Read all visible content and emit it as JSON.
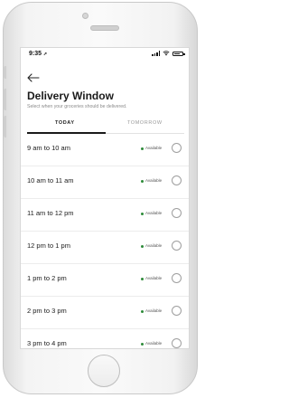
{
  "status_bar": {
    "time": "9:35",
    "location_arrow": "➚"
  },
  "header": {
    "title": "Delivery Window",
    "subtitle": "Select when your groceries should be delivered."
  },
  "tabs": [
    {
      "label": "TODAY",
      "selected": true
    },
    {
      "label": "TOMORROW",
      "selected": false
    }
  ],
  "slots": [
    {
      "label": "9 am to 10 am",
      "status": "Available",
      "selected": false
    },
    {
      "label": "10 am to 11 am",
      "status": "Available",
      "selected": false
    },
    {
      "label": "11 am to 12 pm",
      "status": "Available",
      "selected": false
    },
    {
      "label": "12 pm to 1 pm",
      "status": "Available",
      "selected": false
    },
    {
      "label": "1 pm to 2 pm",
      "status": "Available",
      "selected": false
    },
    {
      "label": "2 pm to 3 pm",
      "status": "Available",
      "selected": false
    },
    {
      "label": "3 pm to 4 pm",
      "status": "Available",
      "selected": false
    }
  ],
  "icons": {
    "back": "back-arrow-icon",
    "signal": "signal-icon",
    "wifi": "wifi-icon",
    "battery": "battery-icon",
    "radio": "radio-button-icon"
  },
  "colors": {
    "available": "#2e8b3a",
    "text": "#1a1a1a",
    "muted": "#8a8a8a"
  },
  "battery_level": 0.8
}
